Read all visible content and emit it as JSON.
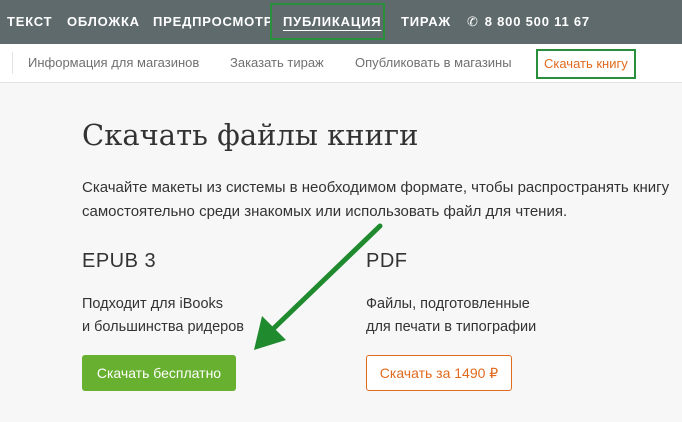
{
  "topnav": {
    "items": [
      "ТЕКСТ",
      "ОБЛОЖКА",
      "ПРЕДПРОСМОТР",
      "ПУБЛИКАЦИЯ",
      "ТИРАЖ"
    ],
    "phone": "8 800 500 11 67"
  },
  "subnav": {
    "items": [
      "Информация для магазинов",
      "Заказать тираж",
      "Опубликовать в магазины",
      "Скачать книгу"
    ]
  },
  "main": {
    "title": "Скачать файлы книги",
    "description": "Скачайте макеты из системы в необходимом формате, чтобы распространять книгу самостоятельно среди знакомых или использовать файл для чтения.",
    "epub": {
      "title": "EPUB 3",
      "line1": "Подходит для iBooks",
      "line2": "и большинства ридеров",
      "button": "Скачать бесплатно"
    },
    "pdf": {
      "title": "PDF",
      "line1": "Файлы, подготовленные",
      "line2": "для печати в типографии",
      "button": "Скачать за 1490 ₽"
    }
  },
  "colors": {
    "topnav_bg": "#5e6a6c",
    "highlight": "#2a8f3a",
    "accent_orange": "#e06a1e",
    "button_green": "#68b030"
  },
  "icons": {
    "phone": "phone-icon",
    "annotation": "arrow-icon"
  }
}
